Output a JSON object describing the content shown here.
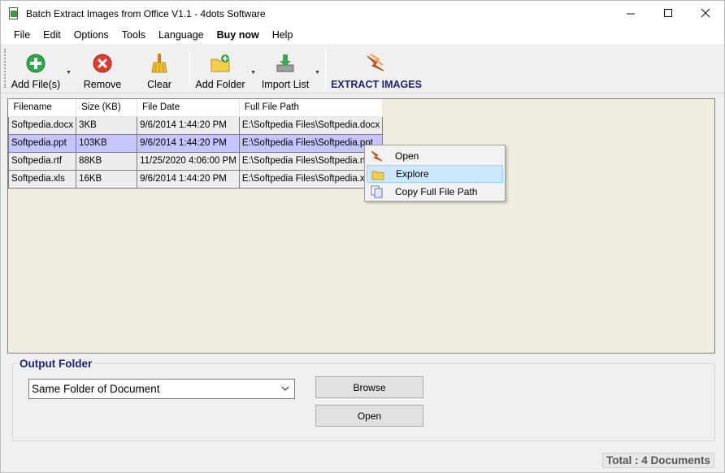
{
  "window": {
    "title": "Batch Extract Images from Office V1.1 - 4dots Software"
  },
  "menu": [
    "File",
    "Edit",
    "Options",
    "Tools",
    "Language",
    "Buy now",
    "Help"
  ],
  "toolbar": {
    "add_files": "Add File(s)",
    "remove": "Remove",
    "clear": "Clear",
    "add_folder": "Add Folder",
    "import_list": "Import List",
    "extract_images": "EXTRACT IMAGES"
  },
  "table": {
    "headers": [
      "Filename",
      "Size (KB)",
      "File Date",
      "Full File Path"
    ],
    "rows": [
      [
        "Softpedia.docx",
        "3KB",
        "9/6/2014 1:44:20 PM",
        "E:\\Softpedia Files\\Softpedia.docx"
      ],
      [
        "Softpedia.ppt",
        "103KB",
        "9/6/2014 1:44:20 PM",
        "E:\\Softpedia Files\\Softpedia.ppt"
      ],
      [
        "Softpedia.rtf",
        "88KB",
        "11/25/2020 4:06:00 PM",
        "E:\\Softpedia Files\\Softpedia.rtf"
      ],
      [
        "Softpedia.xls",
        "16KB",
        "9/6/2014 1:44:20 PM",
        "E:\\Softpedia Files\\Softpedia.xls"
      ]
    ]
  },
  "context_menu": {
    "items": [
      "Open",
      "Explore",
      "Copy Full File Path"
    ],
    "highlighted": "Explore"
  },
  "output": {
    "legend": "Output Folder",
    "selected_folder": "Same Folder of Document",
    "browse": "Browse",
    "open": "Open"
  },
  "status": {
    "total": "Total : 4 Documents"
  },
  "colors": {
    "list_bg": "#f1eee1",
    "selected_row": "#c6c5ff",
    "accent_blue": "#1a237e",
    "menu_highlight": "#cce8ff"
  }
}
